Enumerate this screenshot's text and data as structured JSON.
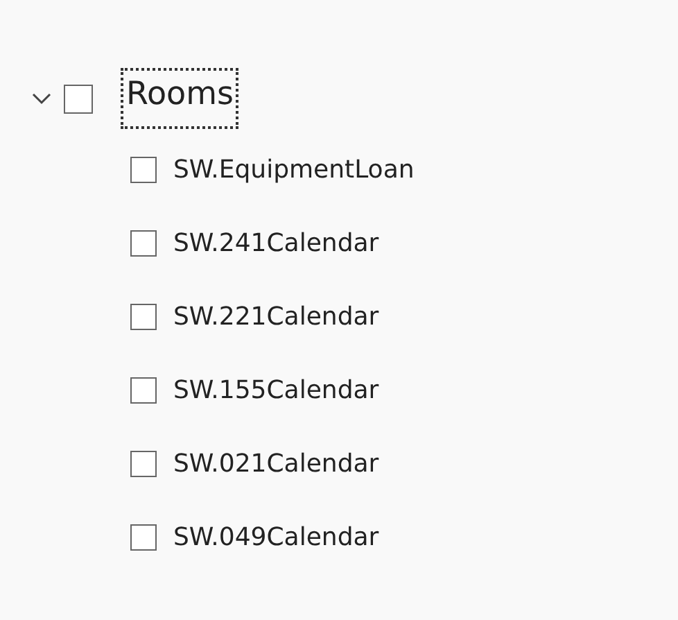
{
  "tree": {
    "label": "Rooms",
    "expanded": true,
    "checked": false,
    "focused": true,
    "children": [
      {
        "label": "SW.EquipmentLoan",
        "checked": false
      },
      {
        "label": "SW.241Calendar",
        "checked": false
      },
      {
        "label": "SW.221Calendar",
        "checked": false
      },
      {
        "label": "SW.155Calendar",
        "checked": false
      },
      {
        "label": "SW.021Calendar",
        "checked": false
      },
      {
        "label": "SW.049Calendar",
        "checked": false
      }
    ]
  }
}
